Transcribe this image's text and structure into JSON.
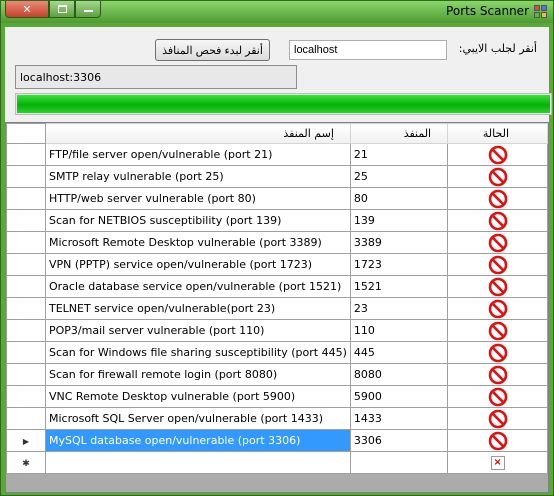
{
  "window": {
    "title": "Ports Scanner",
    "close_glyph": "✕"
  },
  "form": {
    "scan_button_label": "أنقر لبدء فحص المنافذ",
    "ip_input_value": "localhost",
    "ip_label": "أنقر لجلب الايبي:",
    "status_text": "localhost:3306",
    "progress_fraction": 1.0
  },
  "colors": {
    "title_bar": "#5aa838",
    "progress": "#06b006",
    "selection": "#3399ff",
    "status_icon": "#e01010"
  },
  "grid": {
    "headers": {
      "name": "إسم المنفذ",
      "port": "المنفذ",
      "status": "الحالة"
    },
    "rows": [
      {
        "name": "FTP/file server open/vulnerable (port 21)",
        "port": "21",
        "status_icon": "prohibited-icon"
      },
      {
        "name": "SMTP relay vulnerable (port 25)",
        "port": "25",
        "status_icon": "prohibited-icon"
      },
      {
        "name": "HTTP/web server vulnerable (port 80)",
        "port": "80",
        "status_icon": "prohibited-icon"
      },
      {
        "name": "Scan for NETBIOS susceptibility (port 139)",
        "port": "139",
        "status_icon": "prohibited-icon"
      },
      {
        "name": "Microsoft Remote Desktop vulnerable (port 3389)",
        "port": "3389",
        "status_icon": "prohibited-icon"
      },
      {
        "name": "VPN (PPTP) service open/vulnerable (port 1723)",
        "port": "1723",
        "status_icon": "prohibited-icon"
      },
      {
        "name": "Oracle database service open/vulnerable (port 1521)",
        "port": "1521",
        "status_icon": "prohibited-icon"
      },
      {
        "name": "TELNET service open/vulnerable(port 23)",
        "port": "23",
        "status_icon": "prohibited-icon"
      },
      {
        "name": "POP3/mail server vulnerable (port 110)",
        "port": "110",
        "status_icon": "prohibited-icon"
      },
      {
        "name": "Scan for Windows file sharing susceptibility (port 445)",
        "port": "445",
        "status_icon": "prohibited-icon"
      },
      {
        "name": "Scan for firewall remote login (port 8080)",
        "port": "8080",
        "status_icon": "prohibited-icon"
      },
      {
        "name": "VNC Remote Desktop vulnerable (port 5900)",
        "port": "5900",
        "status_icon": "prohibited-icon"
      },
      {
        "name": "Microsoft SQL Server open/vulnerable (port 1433)",
        "port": "1433",
        "status_icon": "prohibited-icon"
      },
      {
        "name": "MySQL database open/vulnerable (port 3306)",
        "port": "3306",
        "status_icon": "prohibited-icon",
        "selected": true
      }
    ],
    "new_row": {
      "name": "",
      "port": "",
      "status_icon": "broken-image-icon"
    }
  }
}
